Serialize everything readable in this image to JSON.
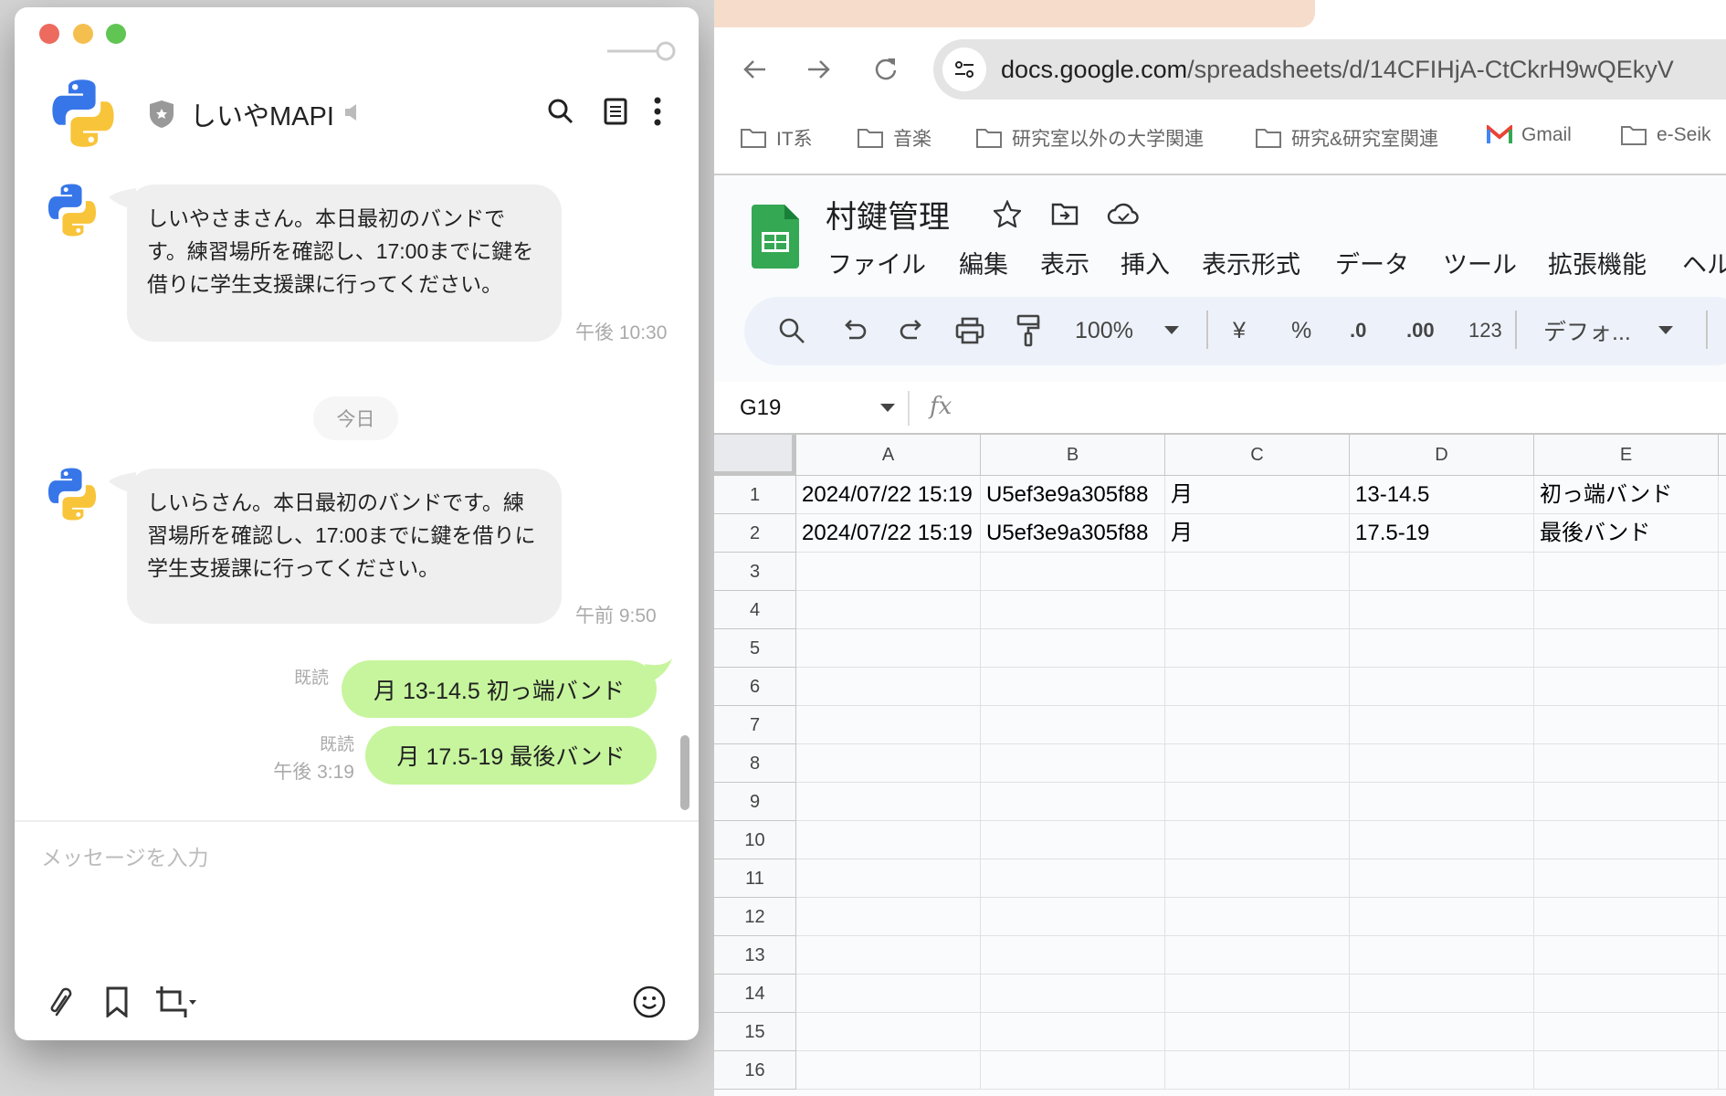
{
  "chat": {
    "title": "しいやMAPI",
    "messages_in": [
      {
        "text": "しいやさまさん。本日最初のバンドです。練習場所を確認し、17:00までに鍵を借りに学生支援課に行ってください。",
        "time": "午後 10:30"
      },
      {
        "text": "しいらさん。本日最初のバンドです。練習場所を確認し、17:00までに鍵を借りに学生支援課に行ってください。",
        "time": "午前 9:50"
      }
    ],
    "date_divider": "今日",
    "messages_out": [
      {
        "text": "月 13-14.5 初っ端バンド",
        "read": "既読"
      },
      {
        "text": "月 17.5-19 最後バンド",
        "read": "既読",
        "time": "午後 3:19"
      }
    ],
    "input_placeholder": "メッセージを入力",
    "colors": {
      "sent_bubble": "#c6f59d",
      "received_bubble": "#efefef"
    }
  },
  "browser": {
    "url_domain": "docs.google.com",
    "url_path": "/spreadsheets/d/14CFIHjA-CtCkrH9wQEkyV",
    "bookmarks": [
      "IT系",
      "音楽",
      "研究室以外の大学関連",
      "研究&研究室関連",
      "Gmail",
      "e-Seik"
    ]
  },
  "sheets": {
    "title": "村鍵管理",
    "menu": [
      "ファイル",
      "編集",
      "表示",
      "挿入",
      "表示形式",
      "データ",
      "ツール",
      "拡張機能",
      "ヘル"
    ],
    "toolbar": {
      "zoom": "100%",
      "currency": "¥",
      "percent": "%",
      "dec_decrease": ".0",
      "dec_increase": ".00",
      "format_number": "123",
      "font": "デフォ..."
    },
    "name_box": "G19",
    "fx": "fx",
    "columns": [
      "A",
      "B",
      "C",
      "D",
      "E"
    ],
    "rows": [
      {
        "num": "1",
        "cells": [
          "2024/07/22 15:19",
          "U5ef3e9a305f88",
          "月",
          "13-14.5",
          "初っ端バンド"
        ]
      },
      {
        "num": "2",
        "cells": [
          "2024/07/22 15:19",
          "U5ef3e9a305f88",
          "月",
          "17.5-19",
          "最後バンド"
        ]
      },
      {
        "num": "3",
        "cells": [
          "",
          "",
          "",
          "",
          ""
        ]
      },
      {
        "num": "4",
        "cells": [
          "",
          "",
          "",
          "",
          ""
        ]
      },
      {
        "num": "5",
        "cells": [
          "",
          "",
          "",
          "",
          ""
        ]
      },
      {
        "num": "6",
        "cells": [
          "",
          "",
          "",
          "",
          ""
        ]
      },
      {
        "num": "7",
        "cells": [
          "",
          "",
          "",
          "",
          ""
        ]
      },
      {
        "num": "8",
        "cells": [
          "",
          "",
          "",
          "",
          ""
        ]
      },
      {
        "num": "9",
        "cells": [
          "",
          "",
          "",
          "",
          ""
        ]
      },
      {
        "num": "10",
        "cells": [
          "",
          "",
          "",
          "",
          ""
        ]
      },
      {
        "num": "11",
        "cells": [
          "",
          "",
          "",
          "",
          ""
        ]
      },
      {
        "num": "12",
        "cells": [
          "",
          "",
          "",
          "",
          ""
        ]
      },
      {
        "num": "13",
        "cells": [
          "",
          "",
          "",
          "",
          ""
        ]
      },
      {
        "num": "14",
        "cells": [
          "",
          "",
          "",
          "",
          ""
        ]
      },
      {
        "num": "15",
        "cells": [
          "",
          "",
          "",
          "",
          ""
        ]
      },
      {
        "num": "16",
        "cells": [
          "",
          "",
          "",
          "",
          ""
        ]
      }
    ]
  }
}
